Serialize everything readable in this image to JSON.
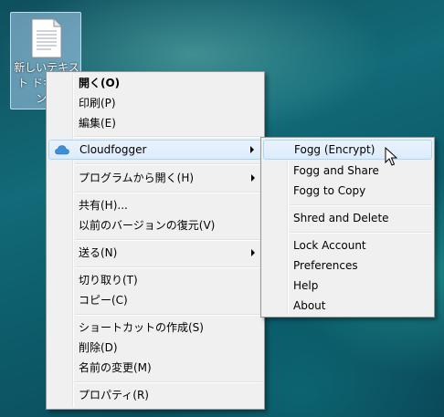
{
  "desktop": {
    "file_label": "新しいテキスト ドキュメント"
  },
  "context_menu": {
    "open": "開く(O)",
    "print": "印刷(P)",
    "edit": "編集(E)",
    "cloudfogger": "Cloudfogger",
    "open_with": "プログラムから開く(H)",
    "share": "共有(H)...",
    "restore_versions": "以前のバージョンの復元(V)",
    "send_to": "送る(N)",
    "cut": "切り取り(T)",
    "copy": "コピー(C)",
    "create_shortcut": "ショートカットの作成(S)",
    "delete": "削除(D)",
    "rename": "名前の変更(M)",
    "properties": "プロパティ(R)"
  },
  "submenu": {
    "fogg_encrypt": "Fogg (Encrypt)",
    "fogg_share": "Fogg and Share",
    "fogg_copy": "Fogg to Copy",
    "shred_delete": "Shred and Delete",
    "lock_account": "Lock Account",
    "preferences": "Preferences",
    "help": "Help",
    "about": "About"
  },
  "icons": {
    "file": "text-document-icon",
    "cloudfogger": "cloud-icon",
    "cursor": "mouse-pointer-icon"
  },
  "colors": {
    "highlight_border": "#a8d8f6",
    "highlight_fill": "#dcebfc",
    "cloud_icon": "#3d8fd6"
  }
}
